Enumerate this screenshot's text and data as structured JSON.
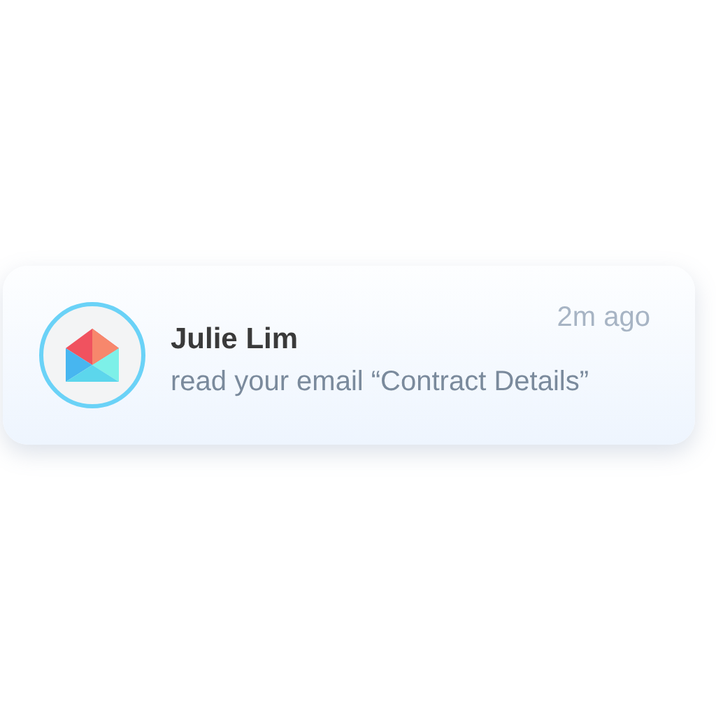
{
  "notification": {
    "sender": "Julie Lim",
    "message": "read your email “Contract Details”",
    "time": "2m ago"
  }
}
